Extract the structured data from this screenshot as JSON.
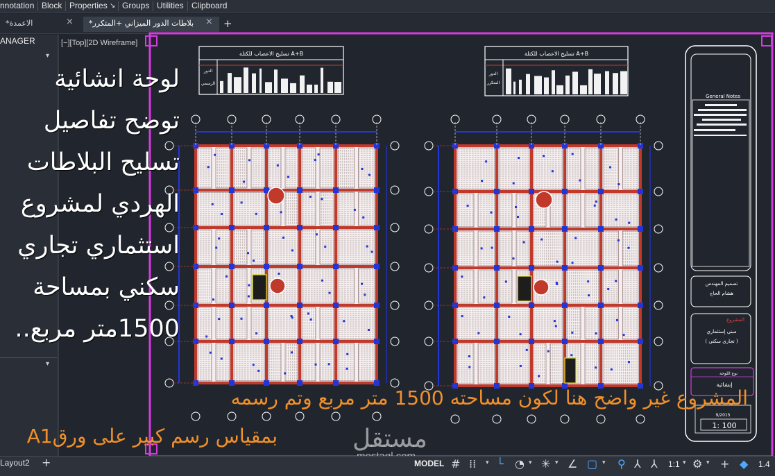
{
  "ribbon": {
    "tabs": [
      "nnotation",
      "Block",
      "Properties",
      "Groups",
      "Utilities",
      "Clipboard"
    ],
    "properties_arrow": "↘"
  },
  "document_tabs": [
    {
      "label": "*الاعمدة",
      "active": false
    },
    {
      "label": "*بلاطات  الدور الميزاني +المتكرر",
      "active": true
    }
  ],
  "add_tab": "+",
  "left_panel": {
    "title": "ANAGER"
  },
  "viewport": {
    "label": "[−][Top][2D Wireframe]"
  },
  "overlay_text": {
    "description": "لوحة انشائية توضح تفاصيل تسليح البلاطات الهردي لمشروع استثماري تجاري سكني بمساحة 1500متر مربع..",
    "caption_line1": "المشروع غير واضح هنا لكون مساحته 1500 متر مربع وتم رسمه",
    "caption_line2": "بمقياس رسم كبير على ورقA1"
  },
  "watermark": {
    "arabic": "مستقل",
    "latin": "mostaql.com"
  },
  "drawing": {
    "schedule_title_left": "تسليح الاعصاب للكتلة A+B",
    "schedule_title_right": "تسليح الاعصاب للكتلة A+B",
    "schedule_rowlabels_left": [
      "الدور",
      "الرسمي"
    ],
    "schedule_rowlabels_right": [
      "الدور",
      "المتكرر"
    ],
    "title_block": {
      "general_notes": "General Notes",
      "designer_label": "تصميم المهندس",
      "designer_name": "هشام الحاج",
      "project_label": "المشروع",
      "project_name_1": "مبنى إستثماري",
      "project_name_2": "( تجاري سكني )",
      "sheet_type_label": "نوع اللوحة",
      "sheet_type": "إنشائية",
      "date": "9/2015",
      "scale": "1: 100"
    }
  },
  "status_bar": {
    "layout_tab": "Layout2",
    "add_layout": "+",
    "model": "MODEL",
    "scale": "1:1",
    "version": "1.4"
  },
  "colors": {
    "canvas": "#21262e",
    "magenta_border": "#d63be0",
    "beam_red": "#c0392b",
    "grid_blue": "#2235d8",
    "caption_orange": "#f0902a",
    "status_active_blue": "#4fa8ff"
  },
  "icons": {
    "grid": "grid-icon",
    "snap": "snap-icon",
    "ortho": "ortho-icon",
    "polar": "polar-tracking-icon",
    "osnap": "object-snap-icon",
    "annotation": "annotation-scale-icon",
    "settings": "gear-icon",
    "add": "plus-icon",
    "workspace": "workspace-icon"
  }
}
